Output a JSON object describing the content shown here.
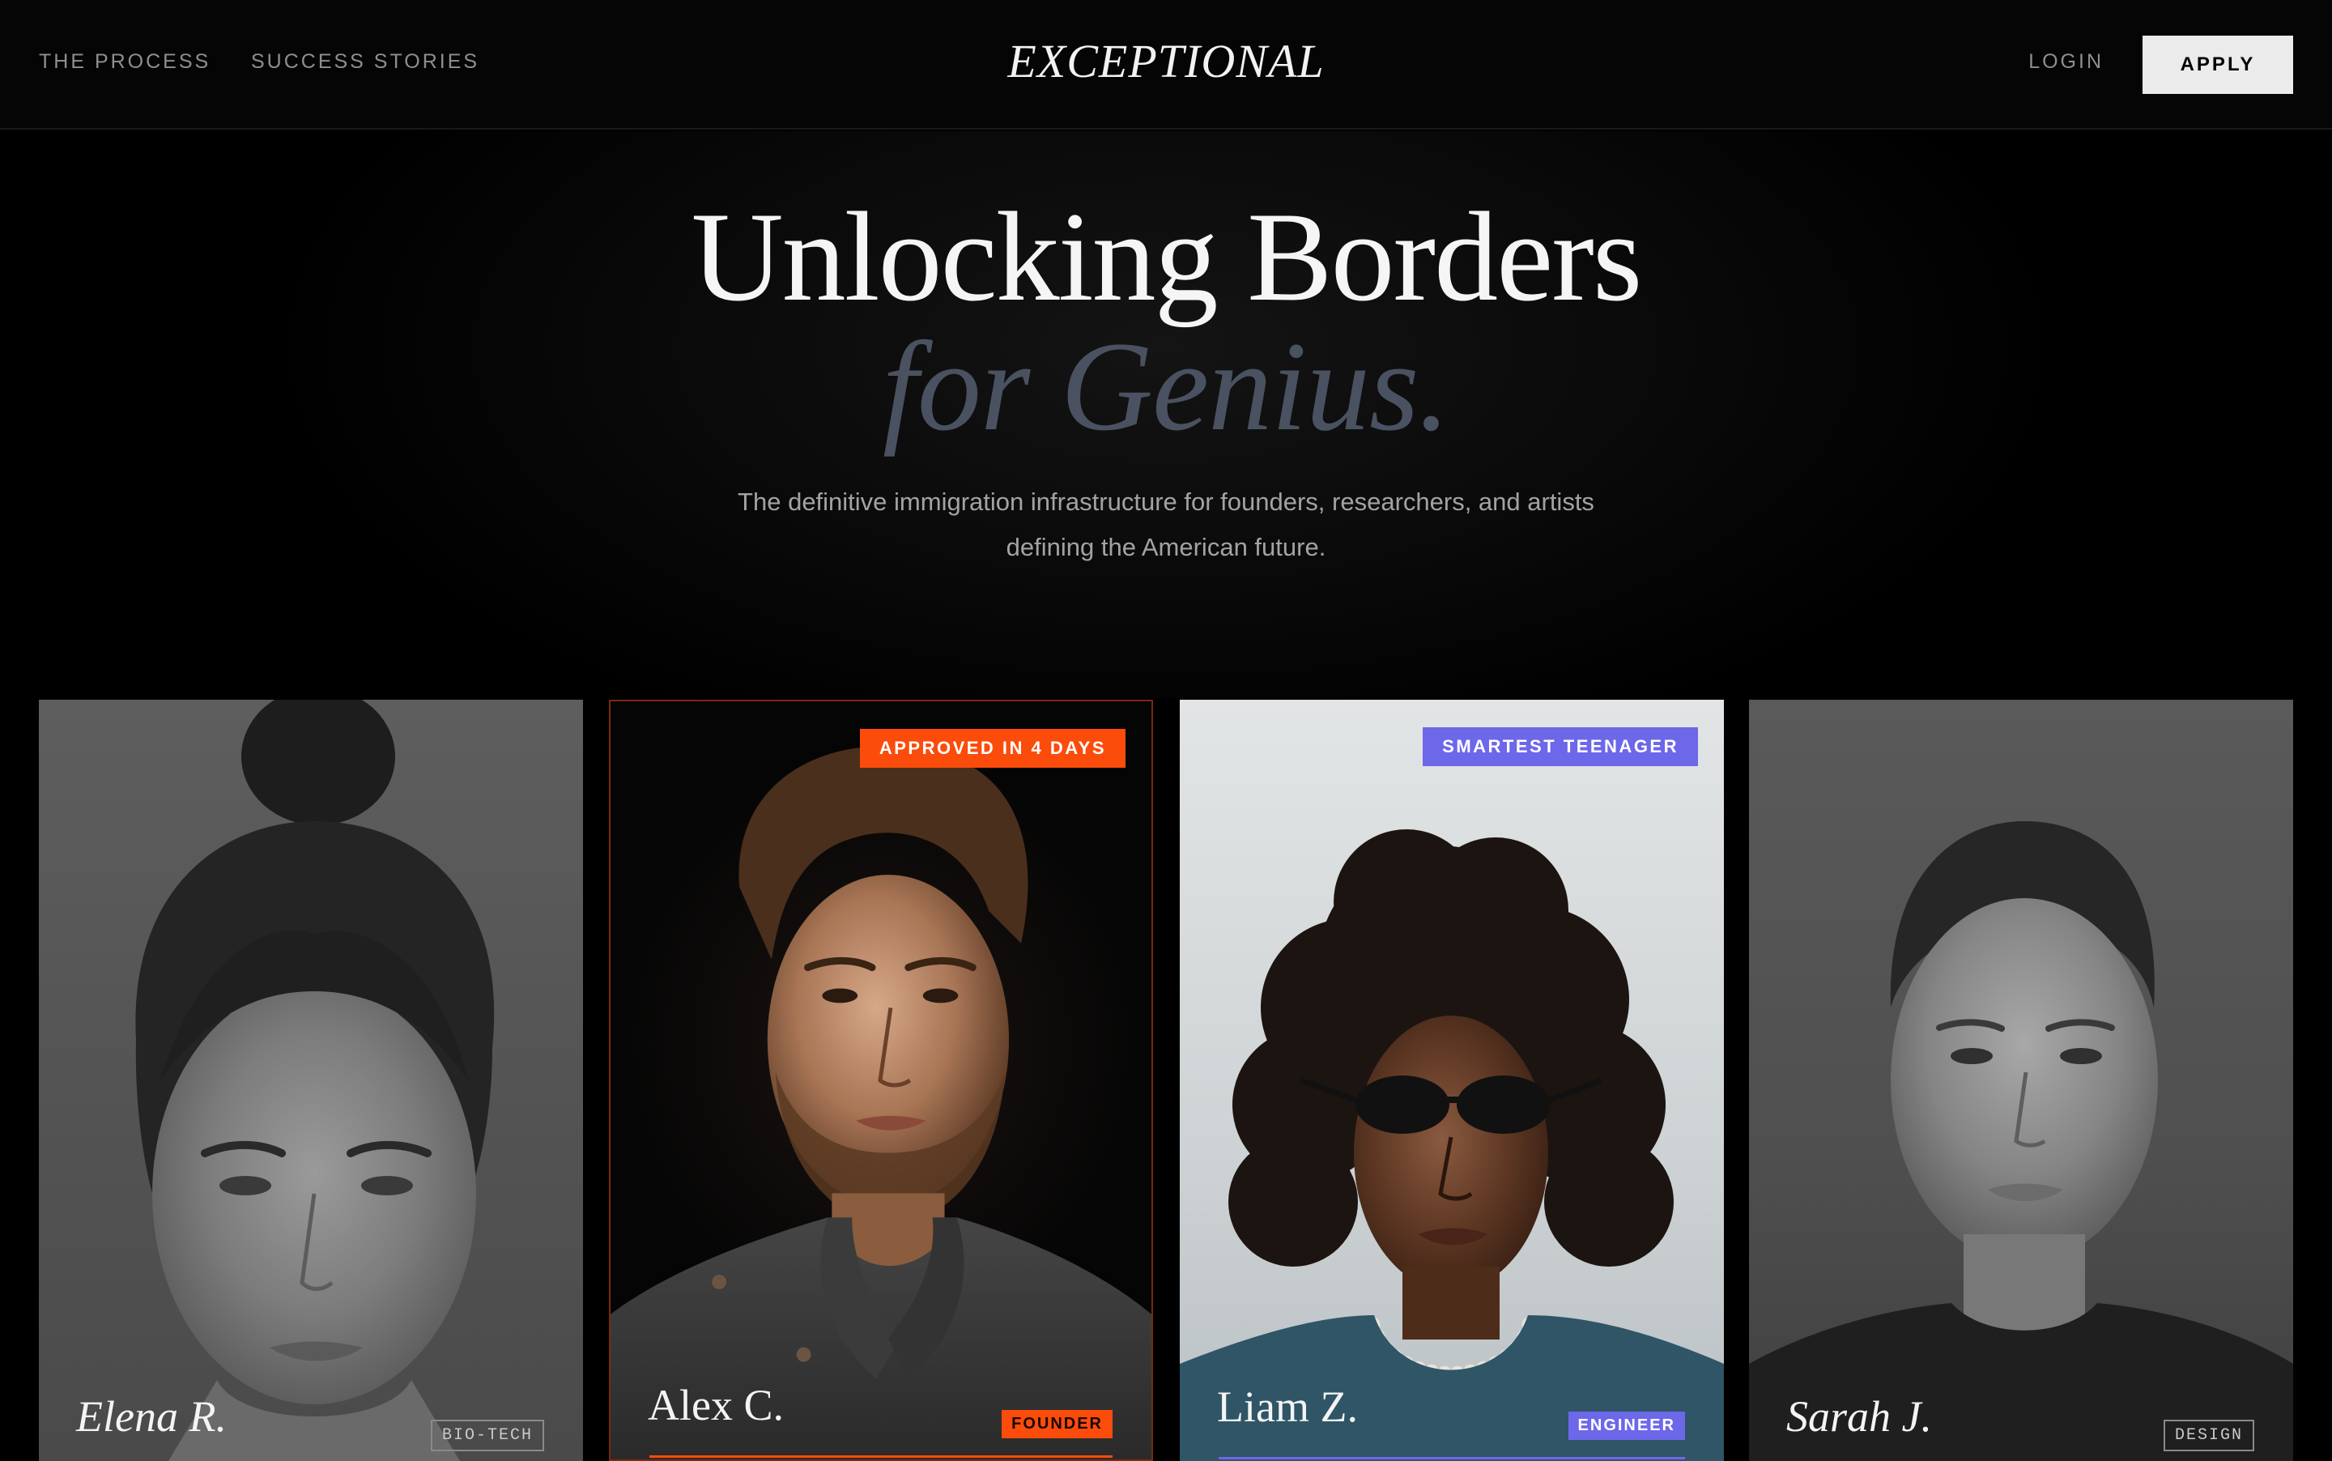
{
  "nav": {
    "links": [
      "THE PROCESS",
      "SUCCESS STORIES"
    ],
    "logo": "EXCEPTIONAL",
    "login": "LOGIN",
    "apply": "APPLY"
  },
  "hero": {
    "title_line1": "Unlocking Borders",
    "title_line2": "for Genius.",
    "subtitle_line1": "The definitive immigration infrastructure for founders, researchers, and artists",
    "subtitle_line2": "defining the American future."
  },
  "cards": [
    {
      "name": "Elena R.",
      "tag": "BIO-TECH",
      "badge": ""
    },
    {
      "name": "Alex C.",
      "tag": "FOUNDER",
      "badge": "APPROVED IN 4 DAYS"
    },
    {
      "name": "Liam Z.",
      "tag": "ENGINEER",
      "badge": "SMARTEST TEENAGER"
    },
    {
      "name": "Sarah J.",
      "tag": "DESIGN",
      "badge": ""
    }
  ],
  "colors": {
    "accent_orange": "#fb4c0b",
    "accent_purple": "#6d67ea",
    "background": "#000000",
    "title_muted": "#4a5261"
  }
}
